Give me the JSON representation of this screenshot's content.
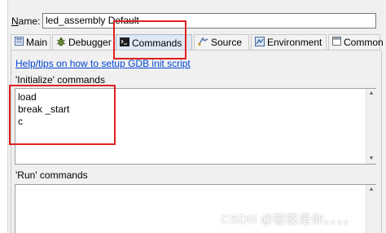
{
  "name_row": {
    "label_underlined": "N",
    "label_rest": "ame:",
    "value": "led_assembly Default"
  },
  "tabs": [
    {
      "label": "Main",
      "icon": "main-tab-icon"
    },
    {
      "label": "Debugger",
      "icon": "debugger-bug-icon"
    },
    {
      "label": "Commands",
      "icon": "terminal-icon",
      "active": true
    },
    {
      "label": "Source",
      "icon": "source-icon"
    },
    {
      "label": "Environment",
      "icon": "environment-icon"
    },
    {
      "label": "Common",
      "icon": "common-icon"
    }
  ],
  "panel": {
    "help_link": "Help/tips on how to setup GDB init script",
    "init_label": "'Initialize' commands",
    "init_commands": "load\nbreak _start\nc",
    "run_label": "'Run' commands",
    "run_commands": ""
  },
  "watermark": "CSDN @憨憨是你。。。。",
  "colors": {
    "annotation_red": "#e02020",
    "link_blue": "#0645d6",
    "active_tab": "#dfe9f5"
  }
}
